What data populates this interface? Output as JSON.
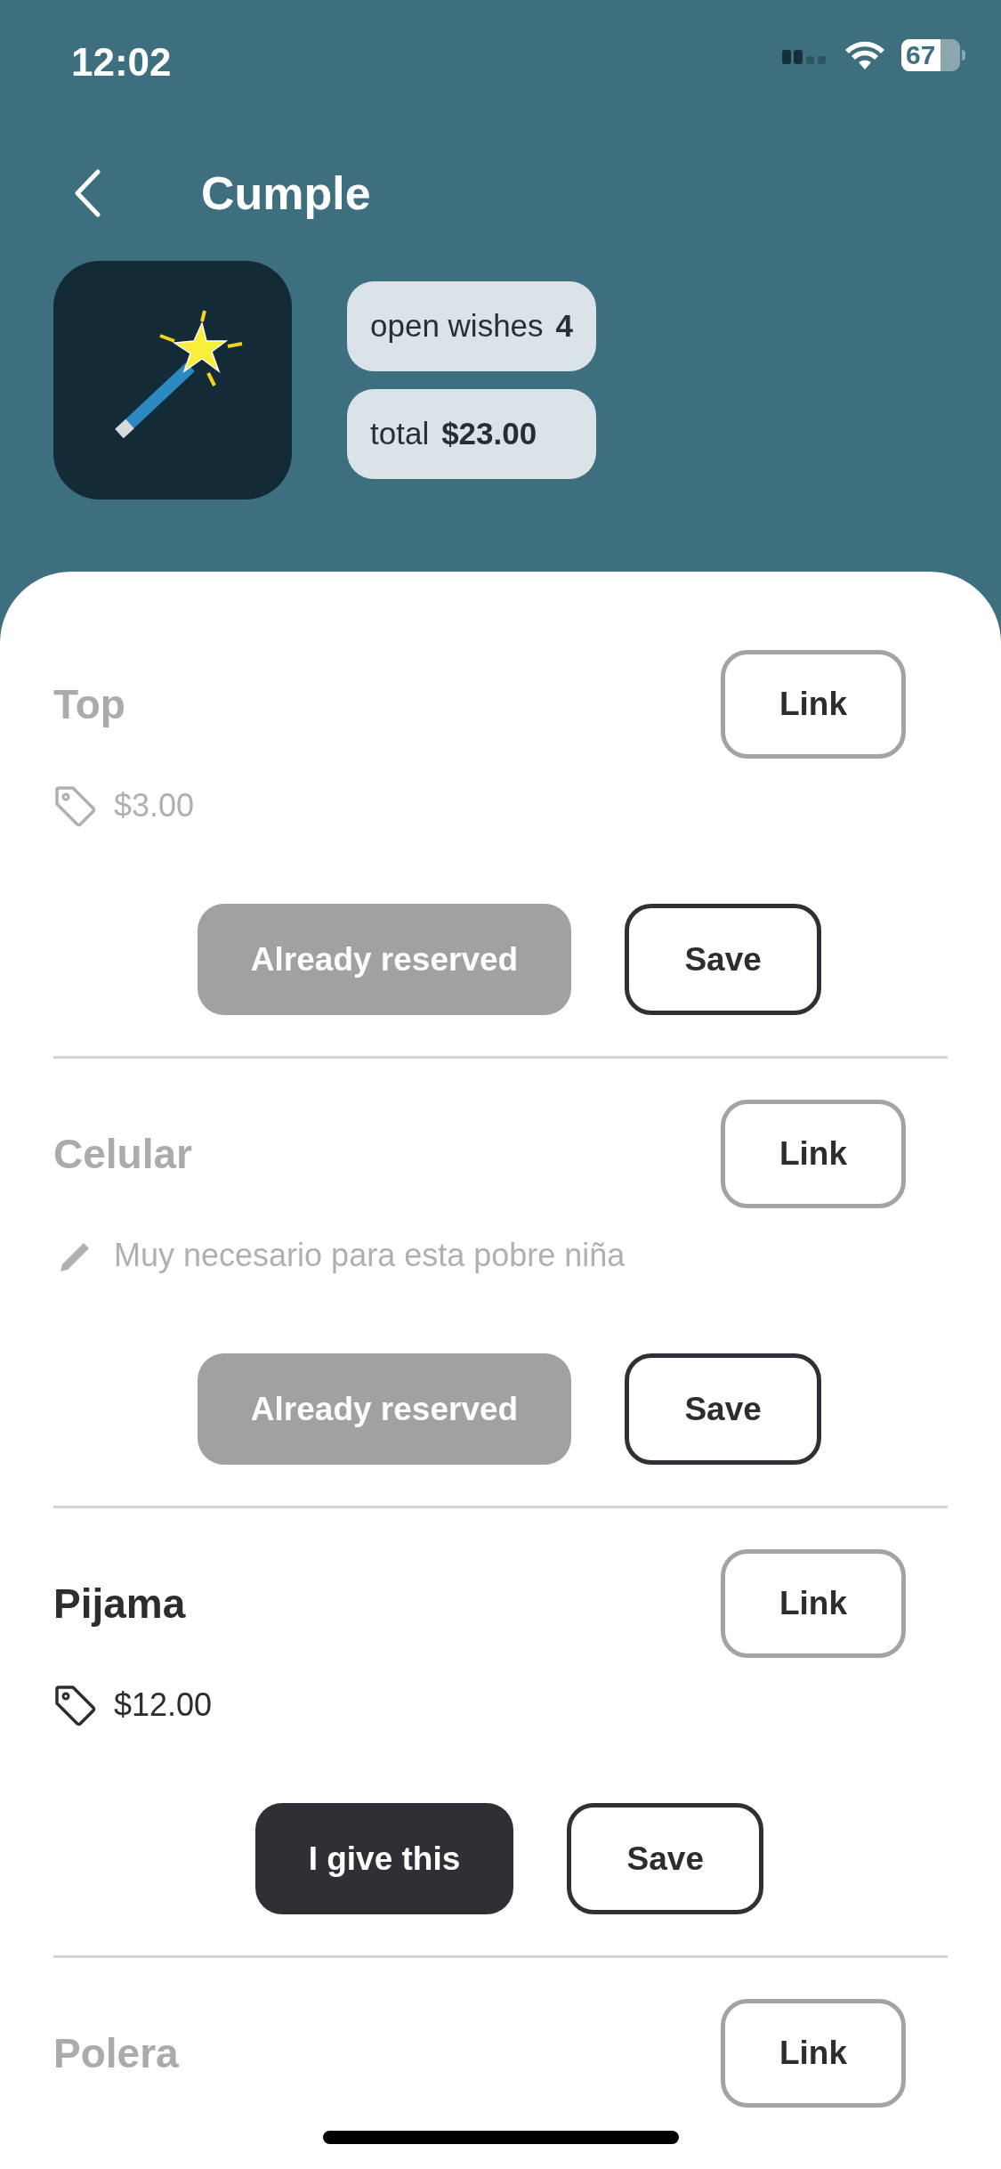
{
  "status_bar": {
    "time": "12:02",
    "battery": "67"
  },
  "header": {
    "title": "Cumple",
    "stats": [
      {
        "label": "open wishes",
        "value": "4"
      },
      {
        "label": "total",
        "value": "$23.00"
      }
    ]
  },
  "wishes": [
    {
      "title": "Top",
      "reserved": true,
      "link": "Link",
      "detail": {
        "kind": "price",
        "text": "$3.00"
      },
      "action": "Already reserved",
      "save": "Save"
    },
    {
      "title": "Celular",
      "reserved": true,
      "link": "Link",
      "detail": {
        "kind": "note",
        "text": "Muy necesario para esta pobre niña"
      },
      "action": "Already reserved",
      "save": "Save"
    },
    {
      "title": "Pijama",
      "reserved": false,
      "link": "Link",
      "detail": {
        "kind": "price",
        "text": "$12.00"
      },
      "action": "I give this",
      "save": "Save"
    },
    {
      "title": "Polera",
      "reserved": true,
      "link": "Link"
    }
  ]
}
